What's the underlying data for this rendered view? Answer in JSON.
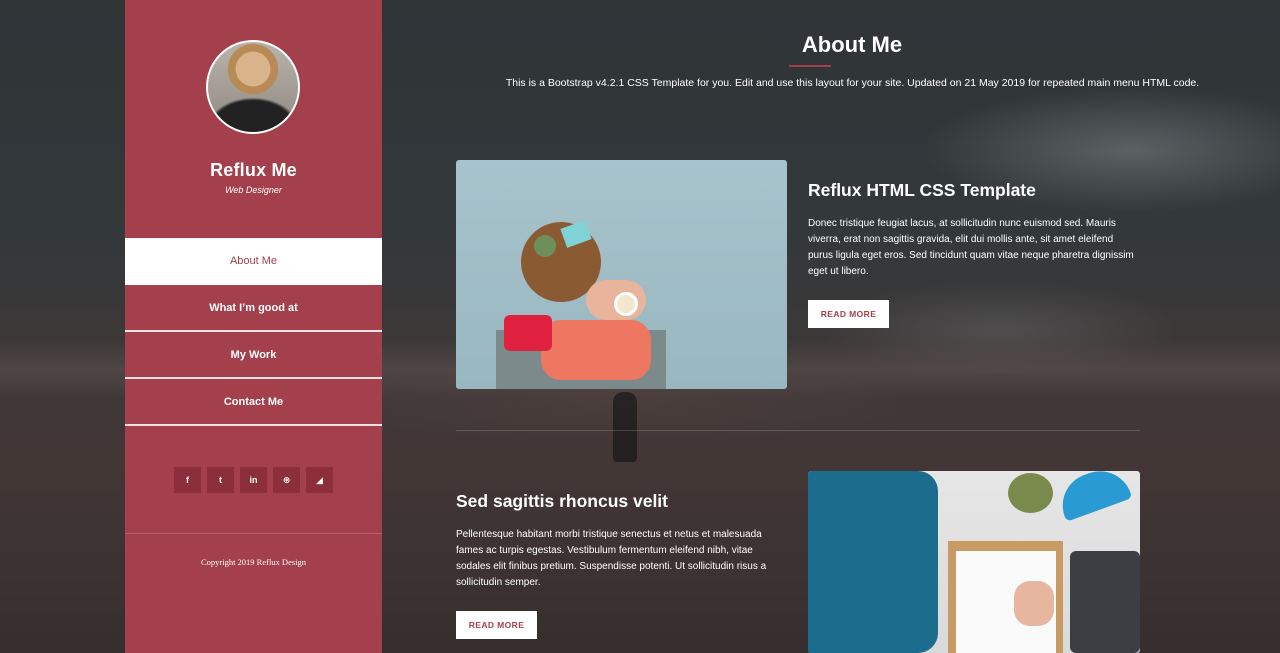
{
  "sidebar": {
    "name": "Reflux Me",
    "role": "Web Designer",
    "nav": [
      {
        "label": "About Me",
        "active": true
      },
      {
        "label": "What I’m good at",
        "active": false
      },
      {
        "label": "My Work",
        "active": false
      },
      {
        "label": "Contact Me",
        "active": false
      }
    ],
    "socials": [
      {
        "icon": "facebook-icon",
        "glyph": "f"
      },
      {
        "icon": "twitter-icon",
        "glyph": "t"
      },
      {
        "icon": "linkedin-icon",
        "glyph": "in"
      },
      {
        "icon": "dribbble-icon",
        "glyph": "⊛"
      },
      {
        "icon": "rss-icon",
        "glyph": "◢"
      }
    ],
    "copyright": "Copyright 2019 Reflux Design"
  },
  "main": {
    "title": "About Me",
    "intro": "This is a Bootstrap v4.2.1 CSS Template for you. Edit and use this layout for your site. Updated on 21 May 2019 for repeated main menu HTML code.",
    "cards": [
      {
        "title": "Reflux HTML CSS Template",
        "text": "Donec tristique feugiat lacus, at sollicitudin nunc euismod sed. Mauris viverra, erat non sagittis gravida, elit dui mollis ante, sit amet eleifend purus ligula eget eros. Sed tincidunt quam vitae neque pharetra dignissim eget ut libero.",
        "button": "READ MORE"
      },
      {
        "title": "Sed sagittis rhoncus velit",
        "text": "Pellentesque habitant morbi tristique senectus et netus et malesuada fames ac turpis egestas. Vestibulum fermentum eleifend nibh, vitae sodales elit finibus pretium. Suspendisse potenti. Ut sollicitudin risus a sollicitudin semper.",
        "button": "READ MORE"
      }
    ]
  },
  "colors": {
    "accent": "#a43f4c",
    "social_bg": "#8d2f3b",
    "text": "#ffffff"
  }
}
